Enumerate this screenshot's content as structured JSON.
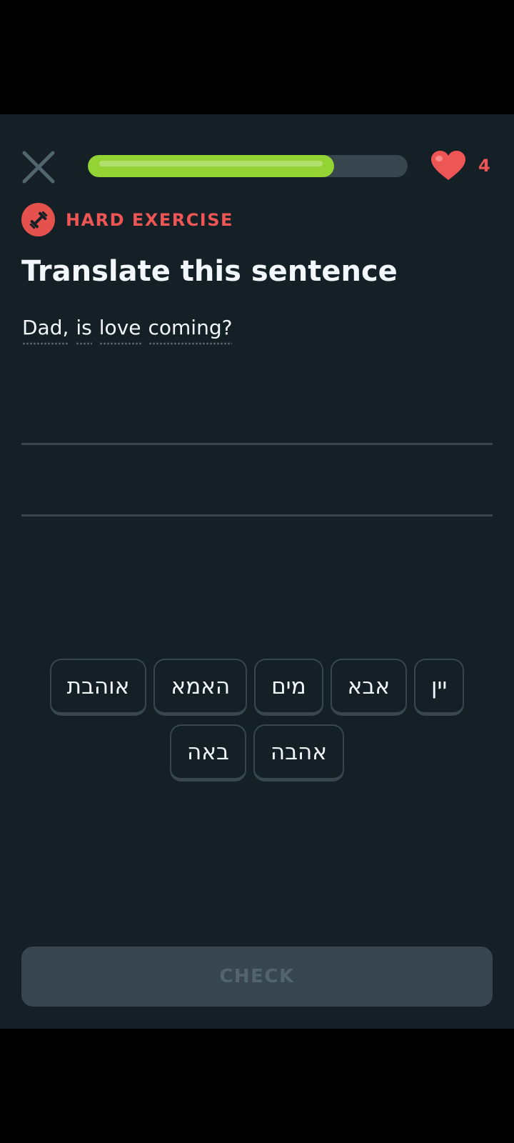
{
  "header": {
    "progress_fraction": 0.77,
    "hearts_count": "4",
    "progress_color": "#93d333",
    "heart_color": "#ee5555"
  },
  "exercise": {
    "badge_label": "HARD EXERCISE",
    "badge_icon": "dumbbell-icon",
    "title": "Translate this sentence",
    "prompt_words": [
      "Dad,",
      "is",
      "love",
      "coming?"
    ]
  },
  "word_bank": {
    "row1": [
      "אוהבת",
      "האמא",
      "מים",
      "אבא",
      "יין"
    ],
    "row2": [
      "באה",
      "אהבה"
    ]
  },
  "footer": {
    "check_label": "CHECK"
  }
}
